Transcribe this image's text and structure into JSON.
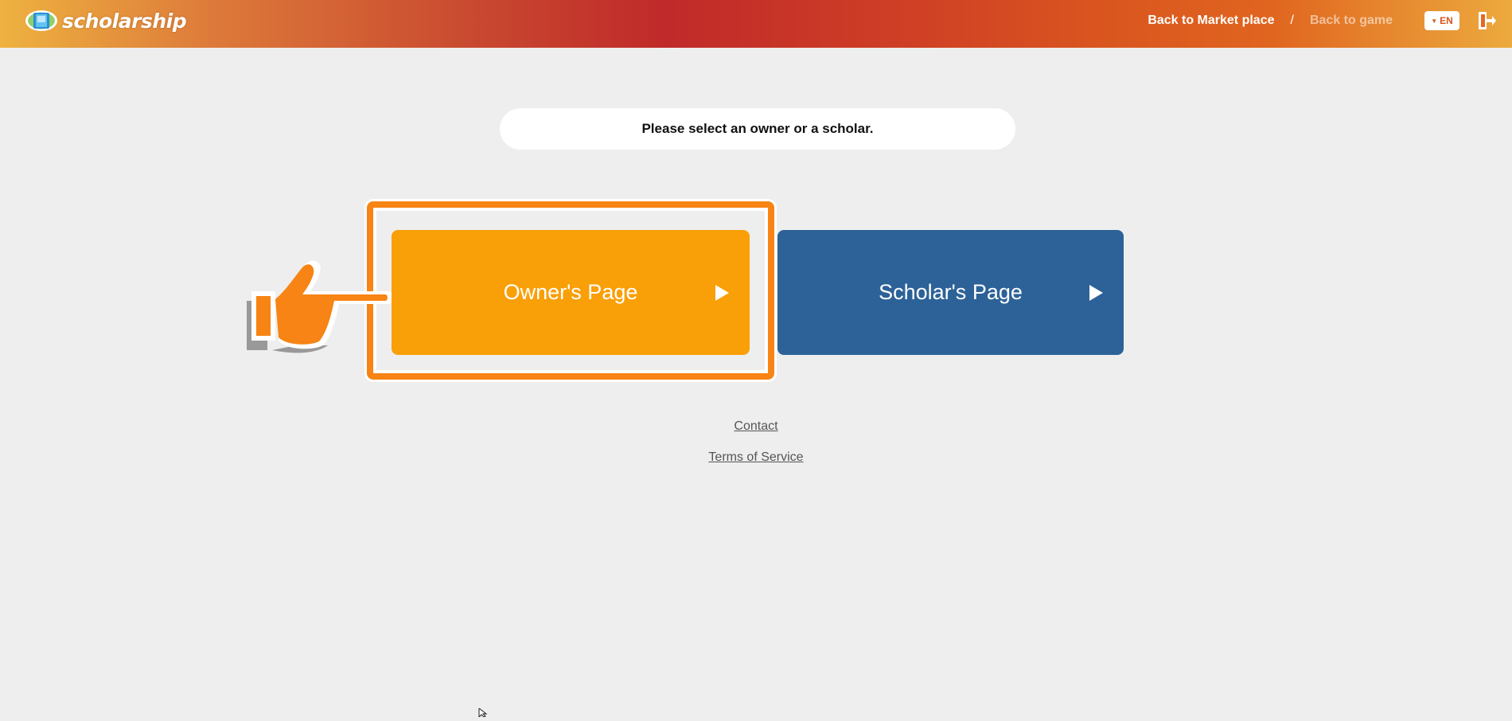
{
  "header": {
    "logo_text": "scholarship",
    "nav": {
      "back_to_market": "Back to Market place",
      "separator": "/",
      "back_to_game": "Back to game"
    },
    "language": "EN"
  },
  "main": {
    "notice": "Please select an owner or a scholar.",
    "owner_button": "Owner's Page",
    "scholar_button": "Scholar's Page"
  },
  "footer": {
    "contact": "Contact",
    "terms": "Terms of Service"
  },
  "colors": {
    "owner": "#f99f07",
    "scholar": "#2c6298",
    "highlight": "#f78414"
  },
  "icons": {
    "logo": "logo-icon",
    "language_chevron": "chevron-down-icon",
    "logout": "logout-icon",
    "pointer": "pointing-hand-icon",
    "arrow": "play-arrow-icon"
  }
}
